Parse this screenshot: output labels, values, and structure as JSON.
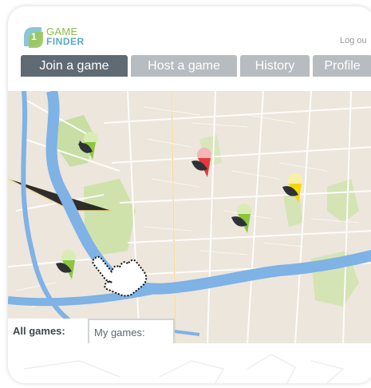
{
  "app": {
    "logo_line1": "GAME",
    "logo_line2": "FINDER",
    "logout": "Log ou"
  },
  "tabs": [
    {
      "label": "Join a game",
      "active": true
    },
    {
      "label": "Host a game",
      "active": false
    },
    {
      "label": "History",
      "active": false
    },
    {
      "label": "Profile",
      "active": false
    }
  ],
  "map": {
    "markers": [
      {
        "name": "map-marker-green-1",
        "color": "#8cc63f"
      },
      {
        "name": "map-marker-red",
        "color": "#e8383d"
      },
      {
        "name": "map-marker-yellow",
        "color": "#f5d800"
      },
      {
        "name": "map-marker-green-2",
        "color": "#8cc63f"
      },
      {
        "name": "map-marker-green-3",
        "color": "#8cc63f"
      }
    ],
    "cursor_icon": "hand-pointer-icon"
  },
  "filters": {
    "all": "All games:",
    "my": "My games:"
  },
  "colors": {
    "tab_active": "#5f6a72",
    "tab_inactive": "#b6bcc0",
    "river": "#7fb2e5",
    "park": "#cce0a8"
  }
}
